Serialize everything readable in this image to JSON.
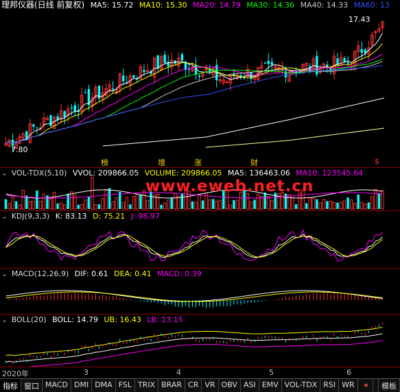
{
  "main": {
    "title": "理邦仪器(日线 前复权)",
    "ma": [
      {
        "label": "MA5: 15.72",
        "color": "#ffffff"
      },
      {
        "label": "MA10: 15.30",
        "color": "#ffff00"
      },
      {
        "label": "MA20: 14.79",
        "color": "#ff00ff"
      },
      {
        "label": "MA30: 14.36",
        "color": "#00ff00"
      },
      {
        "label": "MA40: 14.33",
        "color": "#c8c8c8"
      },
      {
        "label": "MA60: 13",
        "color": "#3050ff"
      }
    ],
    "high_label": "17.43",
    "low_label": "7.80",
    "events": [
      "榜",
      "增",
      "涨",
      "财",
      "$"
    ]
  },
  "vol": {
    "name": "VOL-TDX(5,10)",
    "vvol": "VVOL: 209866.05",
    "volume": "VOLUME: 209866.05",
    "ma5": "MA5: 136463.06",
    "ma10": "MA10: 123545.64"
  },
  "watermark": "www.eweb.net.cn",
  "kdj": {
    "name": "KDJ(9,3,3)",
    "k": "K: 83.13",
    "d": "D: 75.21",
    "j": "J: 98.97"
  },
  "macd": {
    "name": "MACD(12,26,9)",
    "dif": "DIF: 0.61",
    "dea": "DEA: 0.41",
    "macd": "MACD: 0.39"
  },
  "boll": {
    "name": "BOLL(20)",
    "boll": "BOLL: 14.79",
    "ub": "UB: 16.43",
    "lb": "LB: 13.15"
  },
  "xaxis": [
    "2020年",
    "3",
    "4",
    "5",
    "6"
  ],
  "tabs": [
    "指标",
    "窗口",
    "MACD",
    "DMI",
    "DMA",
    "FSL",
    "TRIX",
    "BRAR",
    "CR",
    "VR",
    "OBV",
    "ASI",
    "EMV",
    "VOL-TDX",
    "RSI",
    "WR",
    "模板"
  ],
  "colors": {
    "up": "#ff3232",
    "down": "#00ffff",
    "grid": "#8b0000"
  }
}
